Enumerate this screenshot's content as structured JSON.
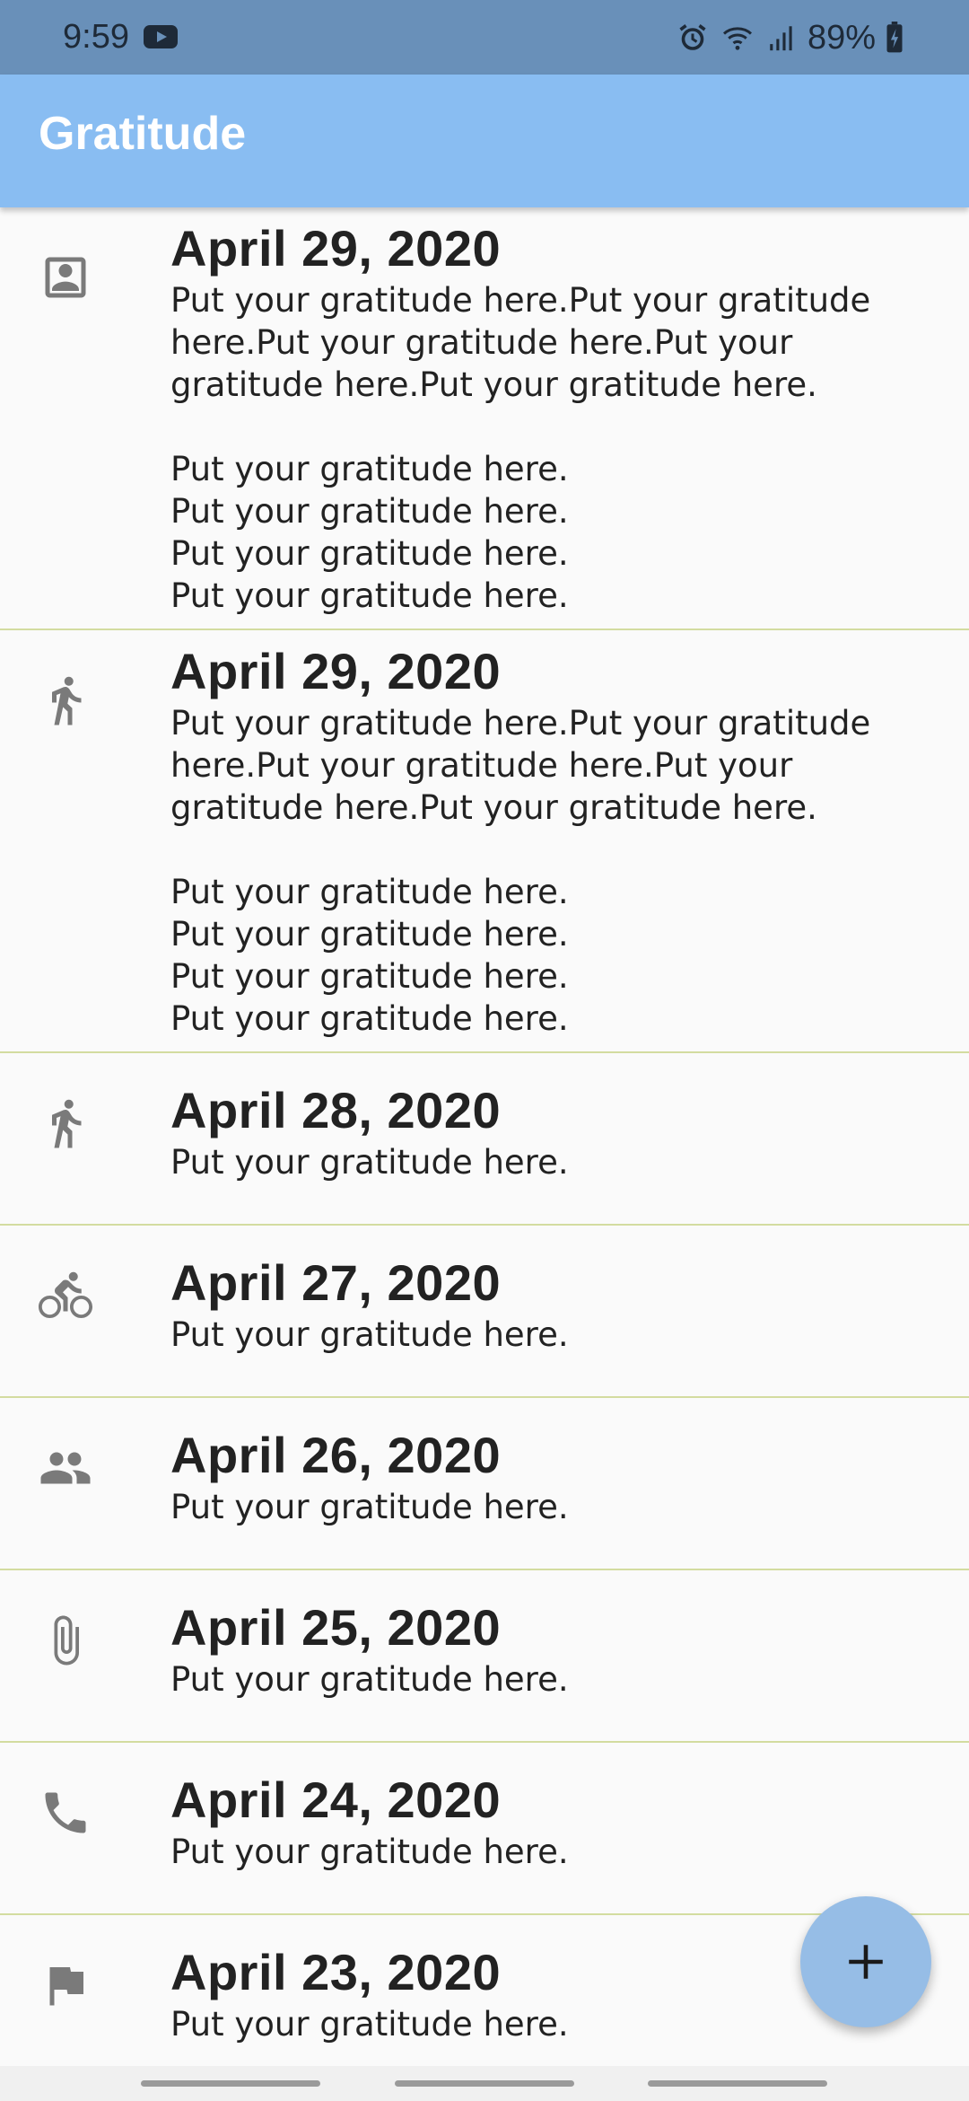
{
  "status_bar": {
    "time": "9:59",
    "battery": "89%"
  },
  "app_bar": {
    "title": "Gratitude"
  },
  "entries": [
    {
      "date": "April 29, 2020",
      "text": "Put your gratitude here.Put your gratitude here.Put your gratitude here.Put your gratitude here.Put your gratitude here.\n\nPut your gratitude here.\nPut your gratitude here.\nPut your gratitude here.\nPut your gratitude here.",
      "icon": "portrait-icon"
    },
    {
      "date": "April 29, 2020",
      "text": "Put your gratitude here.Put your gratitude here.Put your gratitude here.Put your gratitude here.Put your gratitude here.\n\nPut your gratitude here.\nPut your gratitude here.\nPut your gratitude here.\nPut your gratitude here.",
      "icon": "walk-icon"
    },
    {
      "date": "April 28, 2020",
      "text": "Put your gratitude here.",
      "icon": "walk-icon"
    },
    {
      "date": "April 27, 2020",
      "text": "Put your gratitude here.",
      "icon": "bike-icon"
    },
    {
      "date": "April 26, 2020",
      "text": "Put your gratitude here.",
      "icon": "people-icon"
    },
    {
      "date": "April 25, 2020",
      "text": "Put your gratitude here.",
      "icon": "attachment-icon"
    },
    {
      "date": "April 24, 2020",
      "text": "Put your gratitude here.",
      "icon": "phone-icon"
    },
    {
      "date": "April 23, 2020",
      "text": "Put your gratitude here.",
      "icon": "flag-icon"
    }
  ],
  "fab": {
    "icon": "plus-icon"
  },
  "colors": {
    "status_bar": "#6990b9",
    "app_bar": "#89bdf2",
    "fab": "#96bde6",
    "divider": "#d3dca0",
    "icon": "#7a7a7a"
  }
}
